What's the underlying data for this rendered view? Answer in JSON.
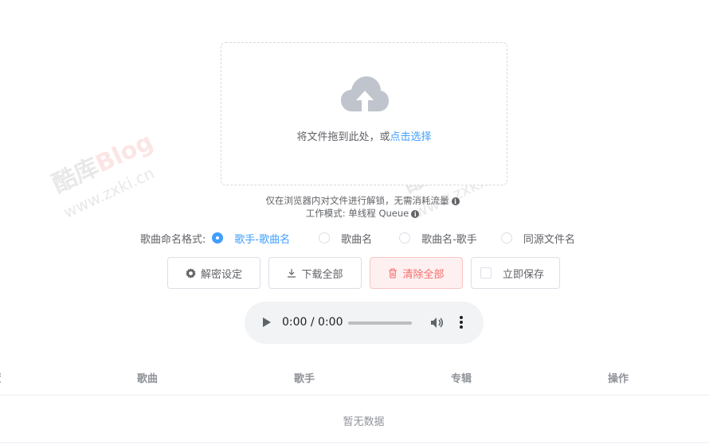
{
  "upload": {
    "prompt": "将文件拖到此处，或",
    "link": "点击选择"
  },
  "tips": {
    "line1": "仅在浏览器内对文件进行解锁，无需消耗流量",
    "line2": "工作模式: 单线程 Queue"
  },
  "naming": {
    "label": "歌曲命名格式:",
    "options": [
      "歌手-歌曲名",
      "歌曲名",
      "歌曲名-歌手",
      "同源文件名"
    ],
    "selected": 0
  },
  "buttons": {
    "decrypt_settings": "解密设定",
    "download_all": "下载全部",
    "clear_all": "清除全部",
    "save_now": "立即保存"
  },
  "player": {
    "time": "0:00 / 0:00"
  },
  "table": {
    "headers": [
      "歌曲",
      "歌手",
      "专辑",
      "操作"
    ],
    "empty": "暂无数据"
  },
  "watermark": {
    "brand_cn": "酷库",
    "brand_en": "Blog",
    "url": "www.zxki.cn"
  },
  "colors": {
    "accent": "#409eff",
    "danger": "#f56c6c",
    "cloud": "#c0c4cc"
  }
}
